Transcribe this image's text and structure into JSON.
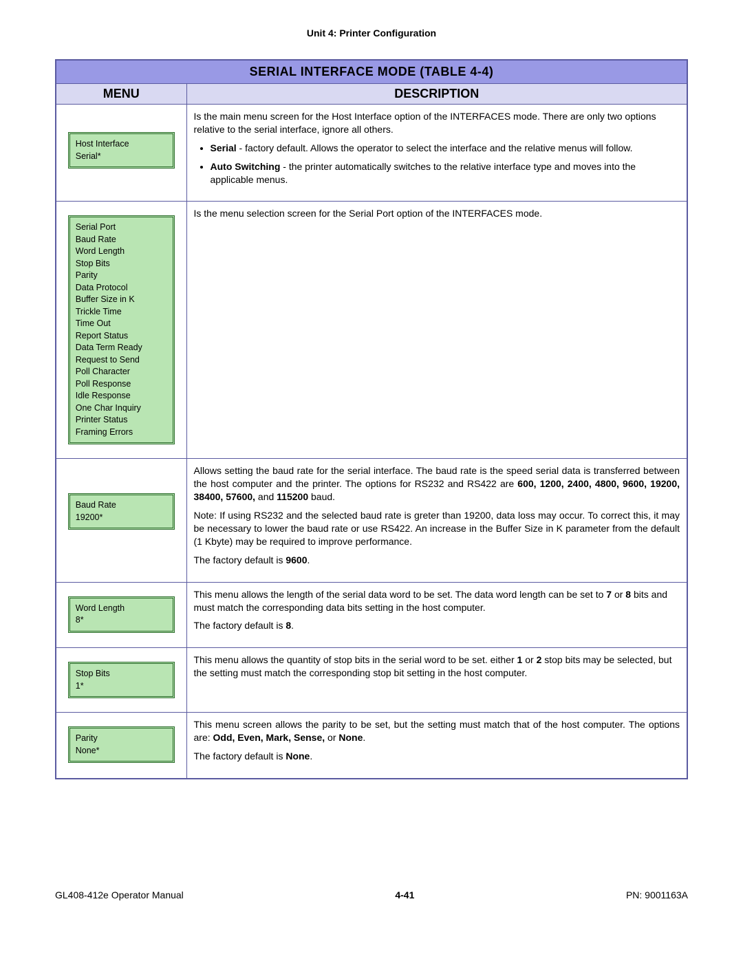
{
  "unit_header": "Unit 4:  Printer Configuration",
  "table_title": "SERIAL INTERFACE MODE (TABLE 4-4)",
  "col_menu": "MENU",
  "col_desc": "DESCRIPTION",
  "rows": {
    "r1": {
      "lcd": "Host Interface\nSerial*",
      "p1": "Is the main menu screen for the Host Interface option of the INTERFACES mode. There are only two options relative to the serial interface, ignore all others.",
      "li1_b": "Serial",
      "li1_t": " - factory default. Allows the operator to select the interface and the relative menus will follow.",
      "li2_b": "Auto Switching",
      "li2_t": " - the printer automatically switches to the relative interface type and moves into the applicable menus."
    },
    "r2": {
      "lcd": "Serial Port\nBaud Rate\nWord Length\nStop Bits\nParity\nData Protocol\nBuffer Size in K\nTrickle Time\nTime Out\nReport Status\nData Term Ready\nRequest to Send\nPoll Character\nPoll Response\nIdle Response\nOne Char Inquiry\nPrinter Status\nFraming Errors",
      "p1": "Is the menu selection screen for the Serial Port option of the INTERFACES mode."
    },
    "r3": {
      "lcd": "Baud Rate\n19200*",
      "p1a": "Allows setting the baud rate for the serial interface. The baud rate is the speed serial data is transferred between the host computer and the printer. The options for RS232 and RS422 are ",
      "p1b": "600, 1200, 2400, 4800, 9600, 19200, 38400, 57600,",
      "p1c": " and ",
      "p1d": "115200",
      "p1e": " baud.",
      "p2": "Note: If using RS232 and the selected baud rate is greter than 19200, data loss may occur. To correct this, it may be necessary to lower the baud rate or use RS422. An increase in the Buffer Size in K parameter from the default (1 Kbyte) may be required to improve performance.",
      "p3a": "The factory default is ",
      "p3b": "9600",
      "p3c": "."
    },
    "r4": {
      "lcd": "Word Length\n8*",
      "p1a": "This menu allows the length of the serial data word to be set. The data word length can be set to ",
      "p1b": "7",
      "p1c": " or ",
      "p1d": "8",
      "p1e": " bits and must match the corresponding data bits setting in the host computer.",
      "p2a": "The factory default is ",
      "p2b": "8",
      "p2c": "."
    },
    "r5": {
      "lcd": "Stop Bits\n1*",
      "p1a": "This menu allows the quantity of stop bits in the serial word to be set. either ",
      "p1b": "1",
      "p1c": " or ",
      "p1d": "2",
      "p1e": " stop bits may be selected, but the setting must match the corresponding stop bit setting in the host computer."
    },
    "r6": {
      "lcd": "Parity\nNone*",
      "p1a": "This menu screen allows the parity to be set, but the setting must match that of the host computer. The options are: ",
      "p1b": "Odd, Even, Mark, Sense,",
      "p1c": " or ",
      "p1d": "None",
      "p1e": ".",
      "p2a": "The factory default is ",
      "p2b": "None",
      "p2c": "."
    }
  },
  "footer": {
    "left": "GL408-412e Operator Manual",
    "center": "4-41",
    "right": "PN: 9001163A"
  }
}
